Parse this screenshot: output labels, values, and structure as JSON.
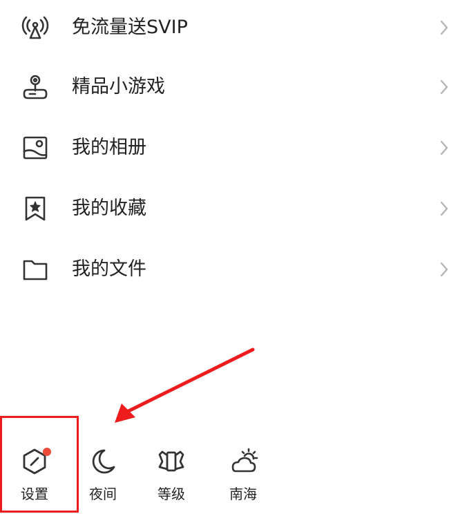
{
  "colors": {
    "text": "#222222",
    "icon": "#333333",
    "chevron": "#b5b5b5",
    "annotation": "#ee1c1c",
    "notify_dot": "#ee4b3a",
    "background": "#ffffff"
  },
  "menu": {
    "items": [
      {
        "label": "免流量送SVIP",
        "icon": "broadcast-tower-icon"
      },
      {
        "label": "精品小游戏",
        "icon": "joystick-icon"
      },
      {
        "label": "我的相册",
        "icon": "photo-album-icon"
      },
      {
        "label": "我的收藏",
        "icon": "bookmark-star-icon"
      },
      {
        "label": "我的文件",
        "icon": "folder-icon"
      }
    ]
  },
  "bottom_bar": {
    "items": [
      {
        "label": "设置",
        "icon": "settings-hexagon-icon",
        "has_notification": true
      },
      {
        "label": "夜间",
        "icon": "moon-icon"
      },
      {
        "label": "等级",
        "icon": "level-badge-icon"
      },
      {
        "label": "南海",
        "icon": "weather-cloud-sun-icon"
      }
    ]
  },
  "annotation": {
    "shape": "red arrow pointing to highlighted settings button",
    "highlight_target": "设置"
  }
}
